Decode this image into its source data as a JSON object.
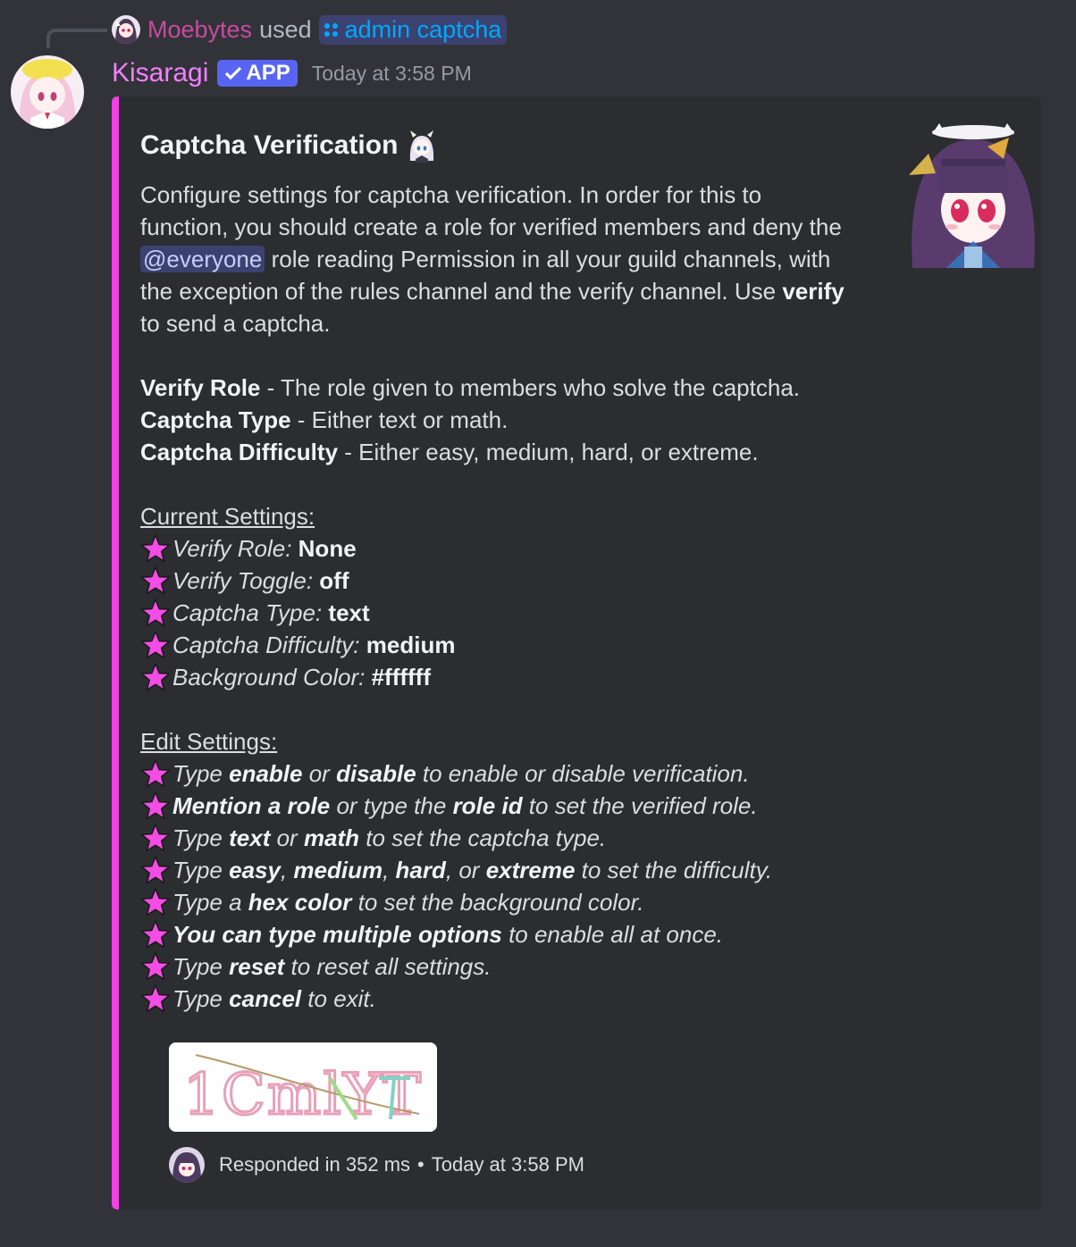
{
  "reply": {
    "user": "Moebytes",
    "used_text": "used",
    "command": "admin captcha"
  },
  "message": {
    "author": "Kisaragi",
    "app_tag": "APP",
    "timestamp": "Today at 3:58 PM"
  },
  "embed": {
    "color": "#f440e7",
    "title": "Captcha Verification",
    "intro": {
      "p1": "Configure settings for captcha verification. In order for this to function, you should create a role for verified members and deny the ",
      "mention": "@everyone",
      "p2": " role reading Permission in all your guild channels, with the exception of the rules channel and the verify channel. Use ",
      "verify": "verify",
      "p3": " to send a captcha."
    },
    "definitions": [
      {
        "term": "Verify Role",
        "text": " - The role given to members who solve the captcha."
      },
      {
        "term": "Captcha Type",
        "text": " - Either text or math."
      },
      {
        "term": "Captcha Difficulty",
        "text": " - Either easy, medium, hard, or extreme."
      }
    ],
    "current_heading": "Current Settings:",
    "current_settings": [
      {
        "label": "Verify Role:",
        "value": "None"
      },
      {
        "label": "Verify Toggle:",
        "value": "off"
      },
      {
        "label": "Captcha Type:",
        "value": "text"
      },
      {
        "label": "Captcha Difficulty:",
        "value": "medium"
      },
      {
        "label": "Background Color:",
        "value": "#ffffff"
      }
    ],
    "edit_heading": "Edit Settings:",
    "edit_settings": [
      [
        {
          "t": "Type "
        },
        {
          "b": "enable"
        },
        {
          "t": " or "
        },
        {
          "b": "disable"
        },
        {
          "t": " to enable or disable verification."
        }
      ],
      [
        {
          "b": "Mention a role"
        },
        {
          "t": " or type the "
        },
        {
          "b": "role id"
        },
        {
          "t": " to set the verified role."
        }
      ],
      [
        {
          "t": "Type "
        },
        {
          "b": "text"
        },
        {
          "t": " or "
        },
        {
          "b": "math"
        },
        {
          "t": " to set the captcha type."
        }
      ],
      [
        {
          "t": "Type "
        },
        {
          "b": "easy"
        },
        {
          "t": ", "
        },
        {
          "b": "medium"
        },
        {
          "t": ", "
        },
        {
          "b": "hard"
        },
        {
          "t": ", or "
        },
        {
          "b": "extreme"
        },
        {
          "t": " to set the difficulty."
        }
      ],
      [
        {
          "t": "Type a "
        },
        {
          "b": "hex color"
        },
        {
          "t": " to set the background color."
        }
      ],
      [
        {
          "b": "You can type multiple options"
        },
        {
          "t": " to enable all at once."
        }
      ],
      [
        {
          "t": "Type "
        },
        {
          "b": "reset"
        },
        {
          "t": " to reset all settings."
        }
      ],
      [
        {
          "t": "Type "
        },
        {
          "b": "cancel"
        },
        {
          "t": " to exit."
        }
      ]
    ],
    "captcha_text": "1CmlYT",
    "footer": {
      "text": "Responded in 352 ms",
      "separator": "•",
      "timestamp": "Today at 3:58 PM"
    }
  }
}
